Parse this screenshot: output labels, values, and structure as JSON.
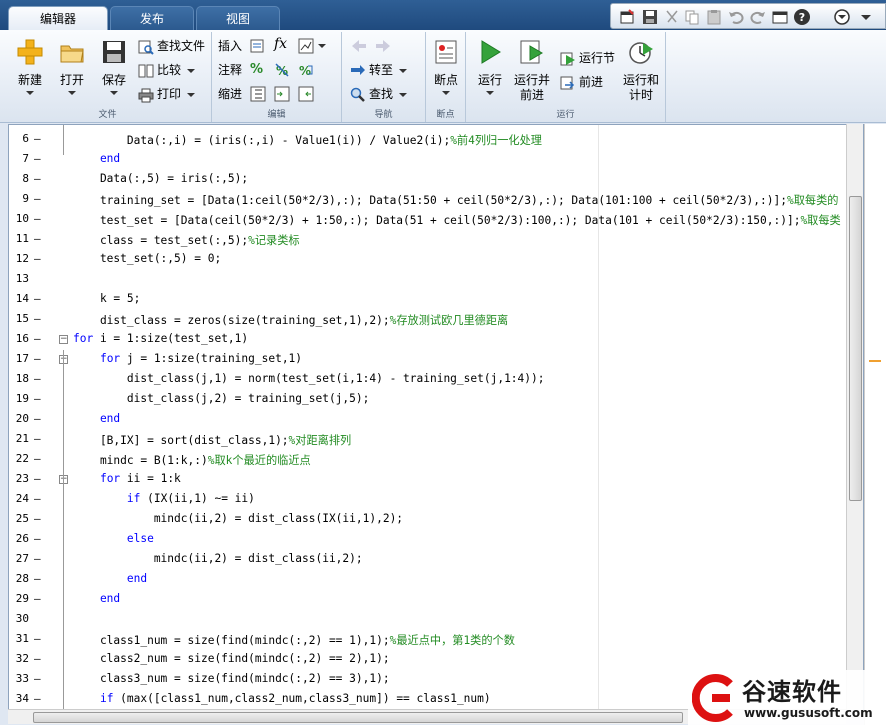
{
  "tabs": [
    {
      "label": "编辑器",
      "active": true
    },
    {
      "label": "发布",
      "active": false
    },
    {
      "label": "视图",
      "active": false
    }
  ],
  "ribbon": {
    "file": {
      "label": "文件",
      "new": "新建",
      "open": "打开",
      "save": "保存",
      "find_files": "查找文件",
      "compare": "比较",
      "print": "打印"
    },
    "edit": {
      "label": "编辑",
      "insert": "插入",
      "comment": "注释",
      "indent": "缩进",
      "fx": "fx"
    },
    "navigate": {
      "label": "导航",
      "goto": "转至",
      "find": "查找"
    },
    "breakpoints": {
      "label": "断点",
      "button": "断点"
    },
    "run": {
      "label": "运行",
      "run": "运行",
      "run_advance_1": "运行并",
      "run_advance_2": "前进",
      "run_section": "运行节",
      "advance": "前进",
      "run_time_1": "运行和",
      "run_time_2": "计时"
    }
  },
  "code_lines": [
    {
      "n": "6",
      "dash": "–",
      "parts": [
        [
          "",
          "        Data(:,i) = (iris(:,i) - Value1(i)) / Value2(i);"
        ],
        [
          "cm",
          "%前4列归一化处理"
        ]
      ]
    },
    {
      "n": "7",
      "dash": "–",
      "parts": [
        [
          "kw",
          "    end"
        ]
      ]
    },
    {
      "n": "8",
      "dash": "–",
      "parts": [
        [
          "",
          "    Data(:,5) = iris(:,5);"
        ]
      ]
    },
    {
      "n": "9",
      "dash": "–",
      "parts": [
        [
          "",
          "    training_set = [Data(1:ceil(50*2/3),:); Data(51:50 + ceil(50*2/3),:); Data(101:100 + ceil(50*2/3),:)];"
        ],
        [
          "cm",
          "%取每类的"
        ]
      ]
    },
    {
      "n": "10",
      "dash": "–",
      "parts": [
        [
          "",
          "    test_set = [Data(ceil(50*2/3) + 1:50,:); Data(51 + ceil(50*2/3):100,:); Data(101 + ceil(50*2/3):150,:)];"
        ],
        [
          "cm",
          "%取每类"
        ]
      ]
    },
    {
      "n": "11",
      "dash": "–",
      "parts": [
        [
          "",
          "    class = test_set(:,5);"
        ],
        [
          "cm",
          "%记录类标"
        ]
      ]
    },
    {
      "n": "12",
      "dash": "–",
      "parts": [
        [
          "",
          "    test_set(:,5) = 0;"
        ]
      ]
    },
    {
      "n": "13",
      "dash": "",
      "parts": [
        [
          "",
          ""
        ]
      ]
    },
    {
      "n": "14",
      "dash": "–",
      "parts": [
        [
          "",
          "    k = 5;"
        ]
      ]
    },
    {
      "n": "15",
      "dash": "–",
      "parts": [
        [
          "",
          "    dist_class = zeros(size(training_set,1),2);"
        ],
        [
          "cm",
          "%存放测试欧几里德距离"
        ]
      ]
    },
    {
      "n": "16",
      "dash": "–",
      "parts": [
        [
          "kw",
          "for"
        ],
        [
          "",
          " i = 1:size(test_set,1)"
        ]
      ]
    },
    {
      "n": "17",
      "dash": "–",
      "parts": [
        [
          "",
          "    "
        ],
        [
          "kw",
          "for"
        ],
        [
          "",
          " j = 1:size(training_set,1)"
        ]
      ]
    },
    {
      "n": "18",
      "dash": "–",
      "parts": [
        [
          "",
          "        dist_class(j,1) = norm(test_set(i,1:4) - training_set(j,1:4));"
        ]
      ]
    },
    {
      "n": "19",
      "dash": "–",
      "parts": [
        [
          "",
          "        dist_class(j,2) = training_set(j,5);"
        ]
      ]
    },
    {
      "n": "20",
      "dash": "–",
      "parts": [
        [
          "kw",
          "    end"
        ]
      ]
    },
    {
      "n": "21",
      "dash": "–",
      "parts": [
        [
          "",
          "    [B,IX] = sort(dist_class,1);"
        ],
        [
          "cm",
          "%对距离排列"
        ]
      ]
    },
    {
      "n": "22",
      "dash": "–",
      "parts": [
        [
          "",
          "    mindc = B(1:k,:)"
        ],
        [
          "cm",
          "%取k个最近的临近点"
        ]
      ]
    },
    {
      "n": "23",
      "dash": "–",
      "parts": [
        [
          "",
          "    "
        ],
        [
          "kw",
          "for"
        ],
        [
          "",
          " ii = 1:k"
        ]
      ]
    },
    {
      "n": "24",
      "dash": "–",
      "parts": [
        [
          "",
          "        "
        ],
        [
          "kw",
          "if"
        ],
        [
          "",
          " (IX(ii,1) ~= ii)"
        ]
      ]
    },
    {
      "n": "25",
      "dash": "–",
      "parts": [
        [
          "",
          "            mindc(ii,2) = dist_class(IX(ii,1),2);"
        ]
      ]
    },
    {
      "n": "26",
      "dash": "–",
      "parts": [
        [
          "kw",
          "        else"
        ]
      ]
    },
    {
      "n": "27",
      "dash": "–",
      "parts": [
        [
          "",
          "            mindc(ii,2) = dist_class(ii,2);"
        ]
      ]
    },
    {
      "n": "28",
      "dash": "–",
      "parts": [
        [
          "kw",
          "        end"
        ]
      ]
    },
    {
      "n": "29",
      "dash": "–",
      "parts": [
        [
          "kw",
          "    end"
        ]
      ]
    },
    {
      "n": "30",
      "dash": "",
      "parts": [
        [
          "",
          ""
        ]
      ]
    },
    {
      "n": "31",
      "dash": "–",
      "parts": [
        [
          "",
          "    class1_num = size(find(mindc(:,2) == 1),1);"
        ],
        [
          "cm",
          "%最近点中，第1类的个数"
        ]
      ]
    },
    {
      "n": "32",
      "dash": "–",
      "parts": [
        [
          "",
          "    class2_num = size(find(mindc(:,2) == 2),1);"
        ]
      ]
    },
    {
      "n": "33",
      "dash": "–",
      "parts": [
        [
          "",
          "    class3_num = size(find(mindc(:,2) == 3),1);"
        ]
      ]
    },
    {
      "n": "34",
      "dash": "–",
      "parts": [
        [
          "",
          "    "
        ],
        [
          "kw",
          "if"
        ],
        [
          "",
          " (max([class1_num,class2_num,class3_num]) == class1_num)"
        ]
      ]
    }
  ],
  "watermark": {
    "title": "谷速软件",
    "url": "www.gususoft.com"
  },
  "colors": {
    "keyword": "#0000ff",
    "comment": "#228b22",
    "tabbar": "#1f4a7e"
  }
}
